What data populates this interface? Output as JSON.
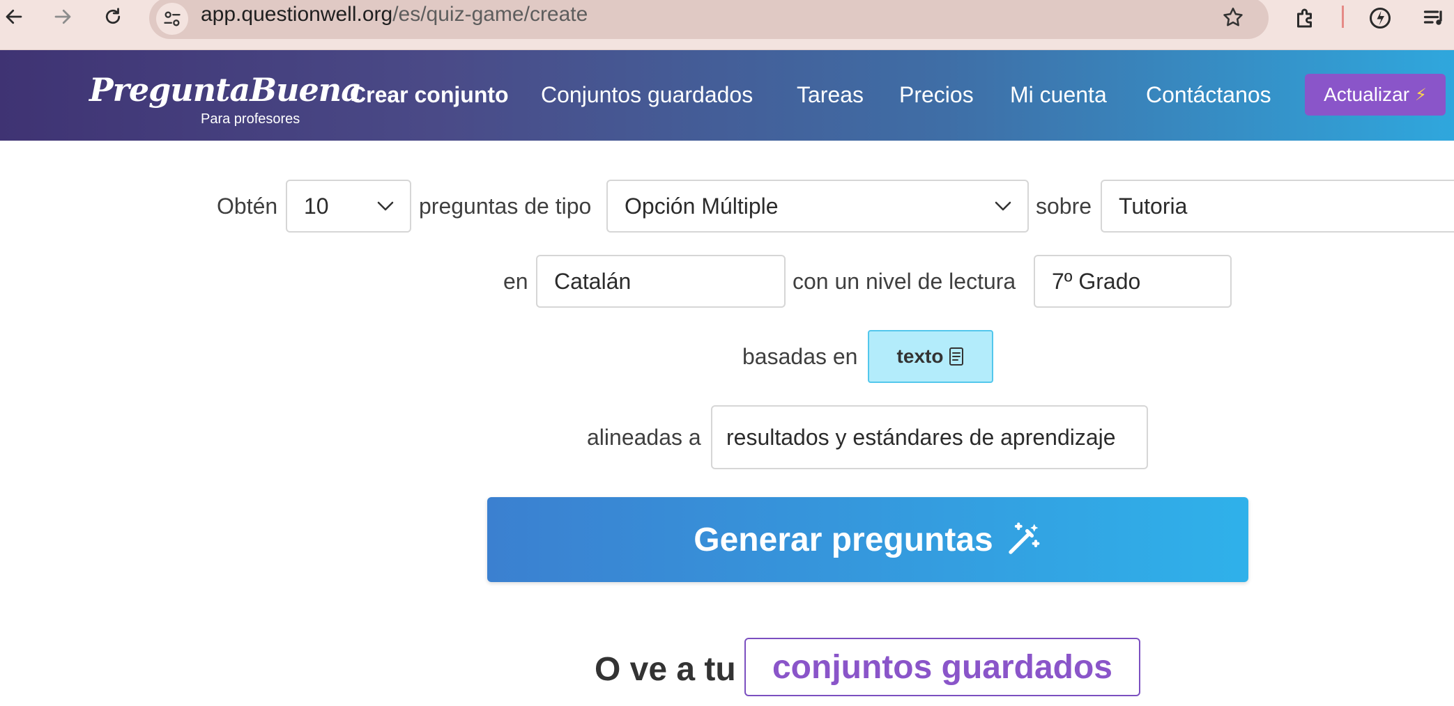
{
  "browser": {
    "url_host": "app.questionwell.org",
    "url_path": "/es/quiz-game/create",
    "icons": [
      "back-arrow-icon",
      "forward-arrow-icon",
      "reload-icon",
      "site-info-icon",
      "star-icon",
      "extensions-icon",
      "extension-leaf-icon",
      "reading-list-icon"
    ]
  },
  "header": {
    "logo": "PreguntaBuena",
    "logo_sub": "Para profesores",
    "menu": [
      "Crear conjunto",
      "Conjuntos guardados",
      "Tareas",
      "Precios",
      "Mi cuenta",
      "Contáctanos"
    ],
    "upgrade_label": "Actualizar",
    "upgrade_icon": "⚡"
  },
  "form": {
    "get_label": "Obtén",
    "count_value": "10",
    "type_label": "preguntas de tipo",
    "type_value": "Opción Múltiple",
    "topic_label": "sobre",
    "topic_value": "Tutoria",
    "lang_label": "en",
    "lang_value": "Catalán",
    "level_label": "con un nivel de lectura",
    "level_value": "7º Grado",
    "based_label": "basadas en",
    "based_value": "texto",
    "aligned_label": "alineadas a",
    "aligned_value": "resultados y estándares de aprendizaje",
    "generate_label": "Generar preguntas",
    "or_label": "O ve a tu",
    "saved_label": "conjuntos guardados"
  },
  "colors": {
    "accent_purple": "#8a55c9",
    "accent_blue": "#2fb1ea",
    "texto_bg": "#b3ecfb"
  }
}
